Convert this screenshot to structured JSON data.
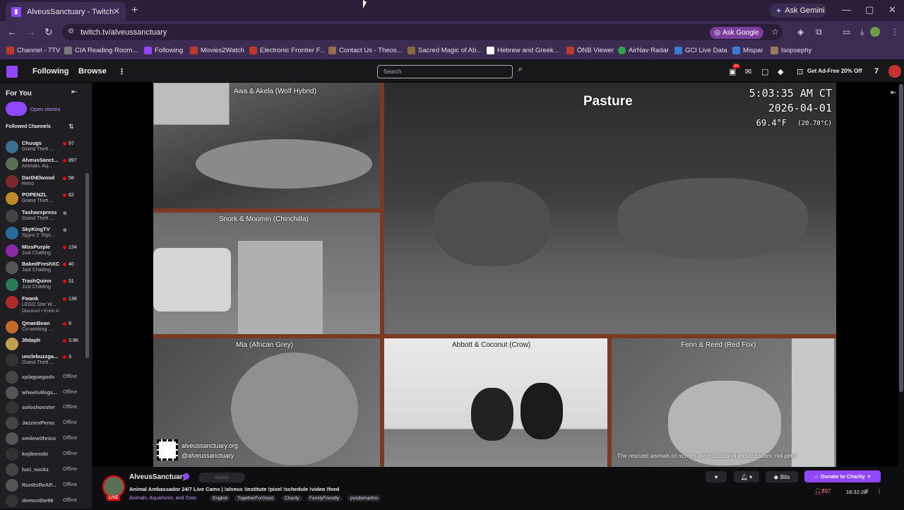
{
  "browser": {
    "tab_title": "AlveusSanctuary - Twitch",
    "tab_close": "✕",
    "new_tab": "+",
    "ask_gemini": "Ask Gemini",
    "url": "twitch.tv/alveussanctuary",
    "ask_google": "Ask Google",
    "bookmarks": [
      "Channel - 7TV",
      "CIA Reading Room...",
      "Following",
      "Movies2Watch",
      "Electronic Frontier F...",
      "Contact Us - Theos...",
      "Sacred Magic of Ab...",
      "Hebrew and Greek...",
      "ÖNB Viewer",
      "AirNav Radar",
      "GCI Live Data",
      "Mispar",
      "Isopsephy"
    ],
    "bookmark_colors": [
      "#c0372c",
      "#7a7a7a",
      "#9146ff",
      "#c0372c",
      "#c0372c",
      "#9a6a4a",
      "#8a6a3a",
      "#ffffff",
      "#c0372c",
      "#2ea44f",
      "#3b7bd6",
      "#3b7bd6",
      "#9a7a5a"
    ]
  },
  "twitch": {
    "nav_following": "Following",
    "nav_browse": "Browse",
    "search_placeholder": "Search",
    "notif_count": "36",
    "ad_free": "Get Ad-Free 20% Off"
  },
  "sidebar": {
    "for_you": "For You",
    "open_stories": "Open stories",
    "followed_channels": "Followed Channels",
    "channels": [
      {
        "name": "Chuugs",
        "game": "Grand Theft ...",
        "viewers": "97",
        "live": true,
        "color": "#3b6e8f"
      },
      {
        "name": "AlveusSanct...",
        "game": "Animals, Aq...",
        "viewers": "897",
        "live": true,
        "color": "#5b6f55"
      },
      {
        "name": "DarthElwood",
        "game": "Retro",
        "viewers": "58",
        "live": true,
        "color": "#7a2a2a"
      },
      {
        "name": "POPENZL",
        "game": "Grand Theft ...",
        "viewers": "62",
        "live": true,
        "color": "#c08a2a"
      },
      {
        "name": "Tashaexpress",
        "game": "Grand Theft ...",
        "viewers": "",
        "live": true,
        "color": "#444"
      },
      {
        "name": "SkyKingTV",
        "game": "Spyro 2: Ript...",
        "viewers": "",
        "live": true,
        "color": "#2a6a9a"
      },
      {
        "name": "MissPurple",
        "game": "Just Chatting",
        "viewers": "134",
        "live": true,
        "color": "#8a2aa8"
      },
      {
        "name": "BakedFreshXC",
        "game": "Just Chatting",
        "viewers": "40",
        "live": true,
        "color": "#555"
      },
      {
        "name": "TrashQuinn",
        "game": "Just Chatting",
        "viewers": "31",
        "live": true,
        "color": "#2a7a5a"
      },
      {
        "name": "Fwank",
        "game": "LEGO Star W...",
        "viewers": "136",
        "live": true,
        "color": "#b02a2a"
      },
      {
        "name": "QmanBean",
        "game": "Co-working ...",
        "viewers": "9",
        "live": true,
        "color": "#c06a2a"
      },
      {
        "name": "39daph",
        "game": "",
        "viewers": "3.9K",
        "live": true,
        "color": "#c0a04a"
      },
      {
        "name": "unclebuzzga...",
        "game": "Grand Theft ...",
        "viewers": "3",
        "live": true,
        "color": "#333"
      },
      {
        "name": "xplaguegodx",
        "game": "",
        "viewers": "Offline",
        "live": false,
        "color": "#444"
      },
      {
        "name": "wheels4legs...",
        "game": "",
        "viewers": "Offline",
        "live": false,
        "color": "#555"
      },
      {
        "name": "soloshooster",
        "game": "",
        "viewers": "Offline",
        "live": false,
        "color": "#333"
      },
      {
        "name": "JazziexPerez",
        "game": "",
        "viewers": "Offline",
        "live": false,
        "color": "#444"
      },
      {
        "name": "smilewithrico",
        "game": "",
        "viewers": "Offline",
        "live": false,
        "color": "#555"
      },
      {
        "name": "kojikenobi",
        "game": "",
        "viewers": "Offline",
        "live": false,
        "color": "#333"
      },
      {
        "name": "luci_suckz",
        "game": "",
        "viewers": "Offline",
        "live": false,
        "color": "#444"
      },
      {
        "name": "RunItsReAP...",
        "game": "",
        "viewers": "Offline",
        "live": false,
        "color": "#555"
      },
      {
        "name": "demonthe99",
        "game": "",
        "viewers": "Offline",
        "live": false,
        "color": "#333"
      }
    ],
    "fwank_promo": "Discount • Ends in"
  },
  "player": {
    "cam_wolf": "Awa & Akela (Wolf Hybrid)",
    "cam_chinchilla": "Snork & Moomin (Chinchilla)",
    "cam_pasture": "Pasture",
    "time": "5:03:35 AM CT",
    "date": "2026-04-01",
    "temp_f": "69.4°F",
    "temp_c": "(20.78°C)",
    "cam_parrot": "Mia (African Grey)",
    "cam_crow": "Abbott & Coconut (Crow)",
    "cam_fox": "Fenn & Reed (Red Fox)",
    "website": "alveussanctuary.org",
    "handle": "@alveussanctuary",
    "disclaimer": "The rescued animals on screen are educational ambassadors, not pets!"
  },
  "channel_info": {
    "name": "AlveusSanctuary",
    "live": "LIVE",
    "knock": "Knock",
    "title": "Animal Ambassador 24/7 Live Cams | !alveus !institute !pixel !schedule !video !feed",
    "category": "Animals, Aquariums, and Zoos",
    "tags": [
      "English",
      "TogetherForGood",
      "Charity",
      "FamilyFriendly",
      "purplemartins"
    ],
    "bits": "Bits",
    "donate": "Donate to Charity",
    "viewers": "897",
    "uptime": "18:32:28"
  }
}
